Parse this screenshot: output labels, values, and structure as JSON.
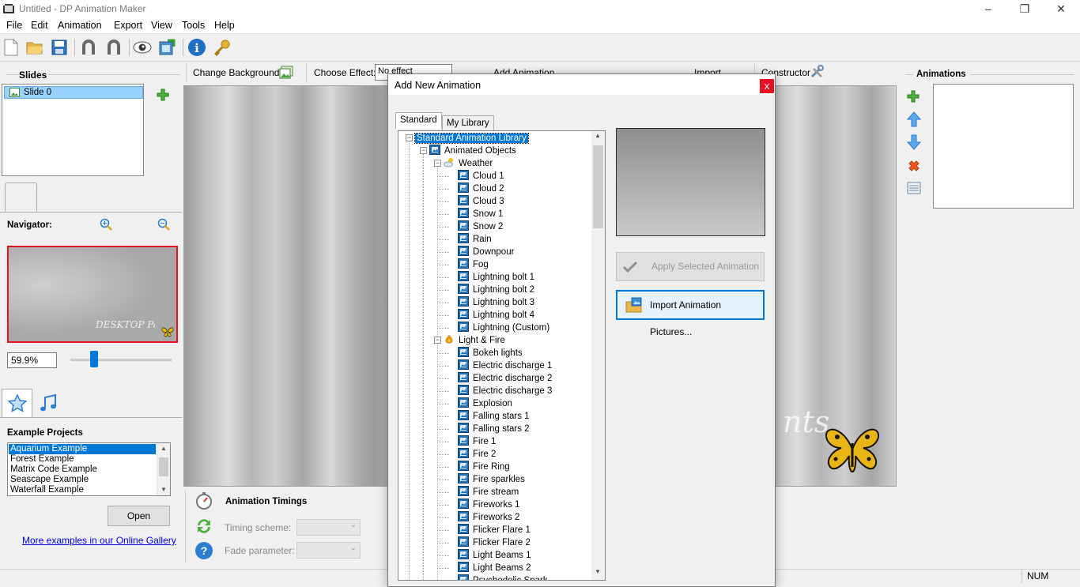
{
  "window": {
    "title": "Untitled - DP Animation Maker"
  },
  "menu": [
    "File",
    "Edit",
    "Animation",
    "Export",
    "View",
    "Tools",
    "Help"
  ],
  "toolbar": {
    "icons": [
      "new-icon",
      "open-icon",
      "save-icon",
      "undo-icon",
      "redo-icon",
      "preview-icon",
      "export-icon",
      "info-icon",
      "key-icon"
    ]
  },
  "left": {
    "slides_header": "Slides",
    "slides": [
      "Slide 0"
    ],
    "navigator_label": "Navigator:",
    "zoom_value": "59.9%",
    "zoom_slider_fraction": 0.2,
    "examples_header": "Example Projects",
    "examples": [
      "Aquarium Example",
      "Forest Example",
      "Matrix Code Example",
      "Seascape Example",
      "Waterfall Example"
    ],
    "examples_selected": 0,
    "open_label": "Open",
    "gallery_link": "More examples in our Online Gallery"
  },
  "center_toolbar": {
    "change_background": "Change Background",
    "choose_effect": "Choose Effect:",
    "effect_value": "No effect",
    "add_animation": "Add Animation",
    "import": "Import",
    "constructor": "Constructor"
  },
  "timings": {
    "header": "Animation Timings",
    "timing_scheme_label": "Timing scheme:",
    "fade_parameter_label": "Fade parameter:"
  },
  "right": {
    "animations_header": "Animations"
  },
  "status": {
    "num": "NUM"
  },
  "dialog": {
    "title": "Add New Animation",
    "close": "x",
    "tabs": [
      "Standard",
      "My Library"
    ],
    "tree_root": "Standard Animation Library",
    "animated_objects": "Animated Objects",
    "weather": "Weather",
    "weather_items": [
      "Cloud 1",
      "Cloud 2",
      "Cloud 3",
      "Snow 1",
      "Snow 2",
      "Rain",
      "Downpour",
      "Fog",
      "Lightning bolt 1",
      "Lightning bolt 2",
      "Lightning bolt 3",
      "Lightning bolt 4",
      "Lightning (Custom)"
    ],
    "light_fire": "Light & Fire",
    "light_fire_items": [
      "Bokeh lights",
      "Electric discharge 1",
      "Electric discharge 2",
      "Electric discharge 3",
      "Explosion",
      "Falling stars 1",
      "Falling stars 2",
      "Fire 1",
      "Fire 2",
      "Fire Ring",
      "Fire sparkles",
      "Fire stream",
      "Fireworks 1",
      "Fireworks 2",
      "Flicker Flare 1",
      "Flicker Flare 2",
      "Light Beams 1",
      "Light Beams 2",
      "Psychedelic Spark"
    ],
    "apply_label": "Apply Selected Animation",
    "import_label": "Import Animation Pictures..."
  },
  "colors": {
    "accent": "#0078d7",
    "selection": "#99d1ff",
    "close": "#e81123",
    "link": "#0000ee"
  }
}
